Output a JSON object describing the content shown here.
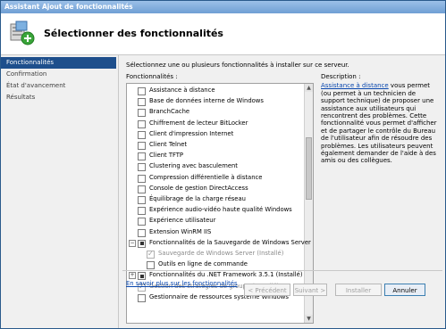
{
  "window": {
    "title": "Assistant Ajout de fonctionnalités"
  },
  "header": {
    "title": "Sélectionner des fonctionnalités"
  },
  "nav": {
    "items": [
      {
        "label": "Fonctionnalités",
        "active": true
      },
      {
        "label": "Confirmation",
        "active": false
      },
      {
        "label": "État d'avancement",
        "active": false
      },
      {
        "label": "Résultats",
        "active": false
      }
    ]
  },
  "content": {
    "intro": "Sélectionnez une ou plusieurs fonctionnalités à installer sur ce serveur.",
    "features_label": "Fonctionnalités :",
    "features": [
      {
        "label": "Assistance à distance",
        "state": "unchecked"
      },
      {
        "label": "Base de données interne de Windows",
        "state": "unchecked"
      },
      {
        "label": "BranchCache",
        "state": "unchecked"
      },
      {
        "label": "Chiffrement de lecteur BitLocker",
        "state": "unchecked"
      },
      {
        "label": "Client d'impression Internet",
        "state": "unchecked"
      },
      {
        "label": "Client Telnet",
        "state": "unchecked"
      },
      {
        "label": "Client TFTP",
        "state": "unchecked"
      },
      {
        "label": "Clustering avec basculement",
        "state": "unchecked"
      },
      {
        "label": "Compression différentielle à distance",
        "state": "unchecked"
      },
      {
        "label": "Console de gestion DirectAccess",
        "state": "unchecked"
      },
      {
        "label": "Équilibrage de la charge réseau",
        "state": "unchecked"
      },
      {
        "label": "Expérience audio-vidéo haute qualité Windows",
        "state": "unchecked"
      },
      {
        "label": "Expérience utilisateur",
        "state": "unchecked"
      },
      {
        "label": "Extension WinRM IIS",
        "state": "unchecked"
      },
      {
        "label": "Fonctionnalités de la Sauvegarde de Windows Server  (Ins",
        "state": "indeterminate",
        "expander": "−"
      },
      {
        "label": "Sauvegarde de Windows Server  (Installé)",
        "state": "checked-disabled",
        "child": true
      },
      {
        "label": "Outils en ligne de commande",
        "state": "unchecked",
        "child": true
      },
      {
        "label": "Fonctionnalités du .NET Framework 3.5.1  (Installé)",
        "state": "indeterminate",
        "expander": "+"
      },
      {
        "label": "Gestion des stratégies de groupe  (Installé)",
        "state": "checked-disabled"
      },
      {
        "label": "Gestionnaire de ressources système Windows",
        "state": "unchecked"
      }
    ],
    "description_heading": "Description :",
    "description_link": "Assistance à distance",
    "description_text": " vous permet (ou permet à un technicien de support technique) de proposer une assistance aux utilisateurs qui rencontrent des problèmes. Cette fonctionnalité vous permet d'afficher et de partager le contrôle du Bureau de l'utilisateur afin de résoudre des problèmes. Les utilisateurs peuvent également demander de l'aide à des amis ou des collègues.",
    "more_link": "En savoir plus sur les fonctionnalités"
  },
  "buttons": {
    "previous": "< Précédent",
    "next": "Suivant >",
    "install": "Installer",
    "cancel": "Annuler"
  }
}
